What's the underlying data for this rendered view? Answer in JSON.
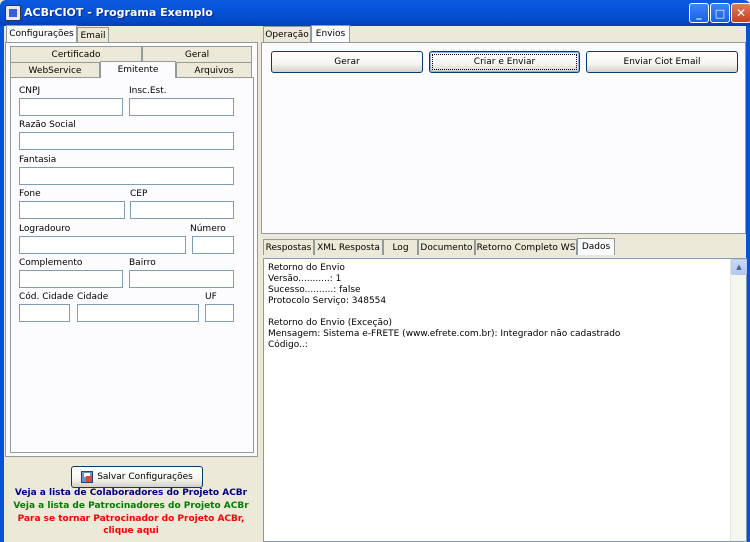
{
  "window": {
    "title": "ACBrCIOT - Programa Exemplo",
    "minimize_glyph": "_",
    "maximize_glyph": "□",
    "close_glyph": "✕"
  },
  "left": {
    "top_tabs": [
      "Configurações",
      "Email"
    ],
    "sub_tabs_row1": [
      "Certificado",
      "Geral"
    ],
    "sub_tabs_row2": [
      "WebService",
      "Emitente",
      "Arquivos"
    ],
    "fields": {
      "cnpj": "CNPJ",
      "insc_est": "Insc.Est.",
      "razao_social": "Razão Social",
      "fantasia": "Fantasia",
      "fone": "Fone",
      "cep": "CEP",
      "logradouro": "Logradouro",
      "numero": "Número",
      "complemento": "Complemento",
      "bairro": "Bairro",
      "cod_cidade": "Cód. Cidade",
      "cidade": "Cidade",
      "uf": "UF"
    },
    "save_button": "Salvar Configurações",
    "links": [
      {
        "text": "Veja a lista de Colaboradores do Projeto ACBr",
        "color": "#000080"
      },
      {
        "text": "Veja a lista de Patrocinadores do Projeto ACBr",
        "color": "#008000"
      },
      {
        "text": "Para se tornar Patrocinador do Projeto ACBr,",
        "color": "#FF0000"
      },
      {
        "text": "clique aqui",
        "color": "#FF0000"
      }
    ]
  },
  "right": {
    "top_tabs": [
      "Operação",
      "Envios"
    ],
    "buttons": [
      "Gerar",
      "Criar e Enviar",
      "Enviar Ciot Email"
    ],
    "bottom_tabs": [
      "Respostas",
      "XML Resposta",
      "Log",
      "Documento",
      "Retorno Completo WS",
      "Dados"
    ],
    "output_lines": [
      "Retorno do Envio",
      "Versão...........: 1",
      "Sucesso..........: false",
      "Protocolo Serviço: 348554",
      "",
      "Retorno do Envio (Exceção)",
      "Mensagem: Sistema e-FRETE (www.efrete.com.br): Integrador não cadastrado",
      "Código..:"
    ]
  }
}
